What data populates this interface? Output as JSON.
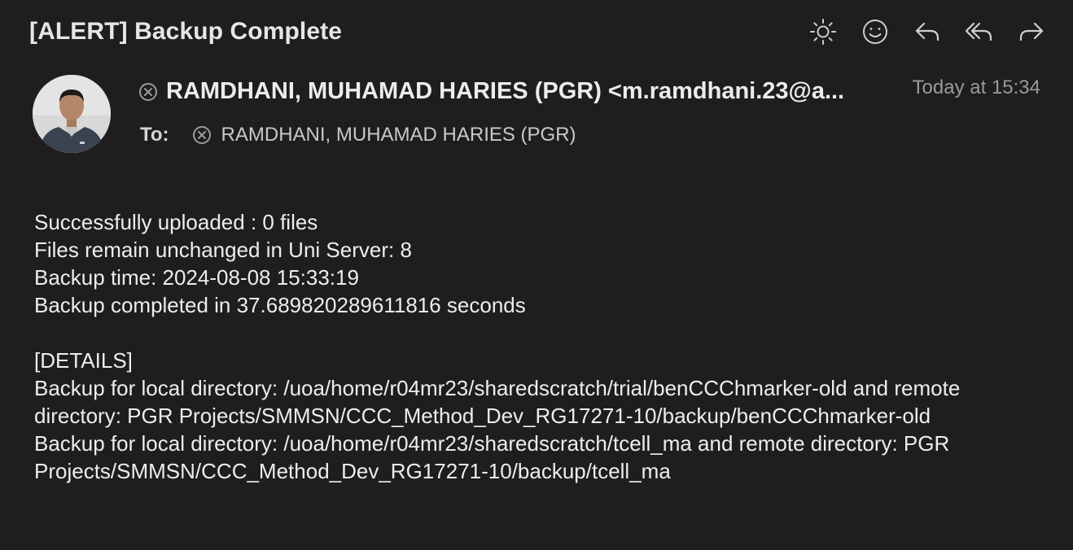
{
  "window": {
    "subject": "[ALERT] Backup Complete"
  },
  "toolbar": {
    "icons": [
      "sun-icon",
      "emoji-icon",
      "reply-icon",
      "reply-all-icon",
      "forward-icon"
    ]
  },
  "header": {
    "from": "RAMDHANI, MUHAMAD HARIES (PGR) <m.ramdhani.23@a...",
    "date": "Today at 15:34",
    "to_label": "To:",
    "to": "RAMDHANI, MUHAMAD HARIES (PGR)"
  },
  "message": {
    "lines": [
      "Successfully uploaded : 0 files",
      "Files remain unchanged in Uni Server: 8",
      "Backup time: 2024-08-08 15:33:19",
      "Backup completed in 37.689820289611816 seconds"
    ],
    "details_heading": "[DETAILS]",
    "details": [
      "Backup for local directory: /uoa/home/r04mr23/sharedscratch/trial/benCCChmarker-old and remote directory: PGR Projects/SMMSN/CCC_Method_Dev_RG17271-10/backup/benCCChmarker-old",
      "Backup for local directory: /uoa/home/r04mr23/sharedscratch/tcell_ma and remote directory: PGR Projects/SMMSN/CCC_Method_Dev_RG17271-10/backup/tcell_ma"
    ]
  },
  "colors": {
    "background": "#1e1e1e",
    "text": "#ebebeb",
    "muted": "#9a9a9a"
  }
}
